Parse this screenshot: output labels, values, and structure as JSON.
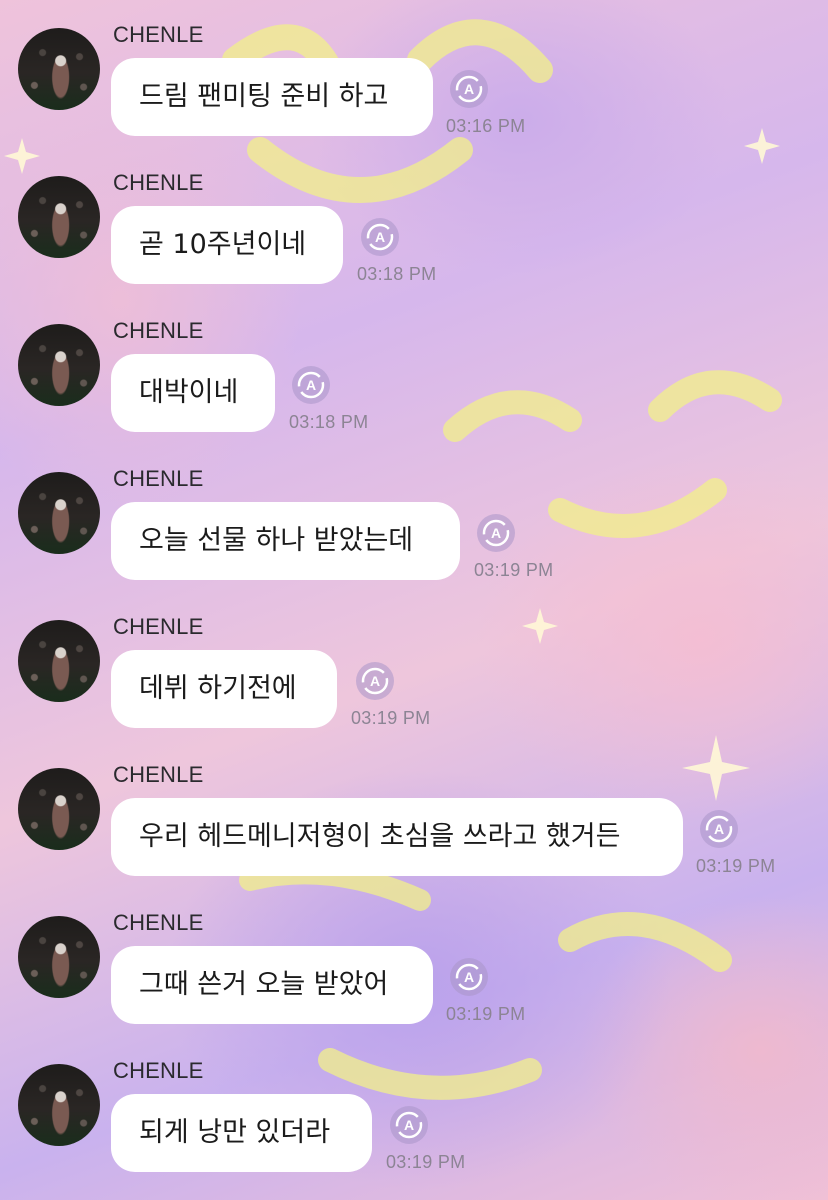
{
  "messages": [
    {
      "sender": "CHENLE",
      "text": "드림 팬미팅 준비 하고",
      "time": "03:16 PM"
    },
    {
      "sender": "CHENLE",
      "text": "곧 10주년이네",
      "time": "03:18 PM"
    },
    {
      "sender": "CHENLE",
      "text": "대박이네",
      "time": "03:18 PM"
    },
    {
      "sender": "CHENLE",
      "text": "오늘 선물 하나 받았는데",
      "time": "03:19 PM"
    },
    {
      "sender": "CHENLE",
      "text": "데뷔 하기전에",
      "time": "03:19 PM"
    },
    {
      "sender": "CHENLE",
      "text": "우리 헤드메니저형이 초심을 쓰라고 했거든",
      "time": "03:19 PM"
    },
    {
      "sender": "CHENLE",
      "text": "그때 쓴거 오늘 받았어",
      "time": "03:19 PM"
    },
    {
      "sender": "CHENLE",
      "text": "되게 낭만 있더라",
      "time": "03:19 PM"
    }
  ],
  "icons": {
    "read_status": "translate-icon",
    "avatar": "avatar"
  },
  "colors": {
    "bubble": "#ffffff",
    "sender_name": "#2a2a2e",
    "timestamp": "#8c8494",
    "icon_bg": "#c8b4de"
  }
}
